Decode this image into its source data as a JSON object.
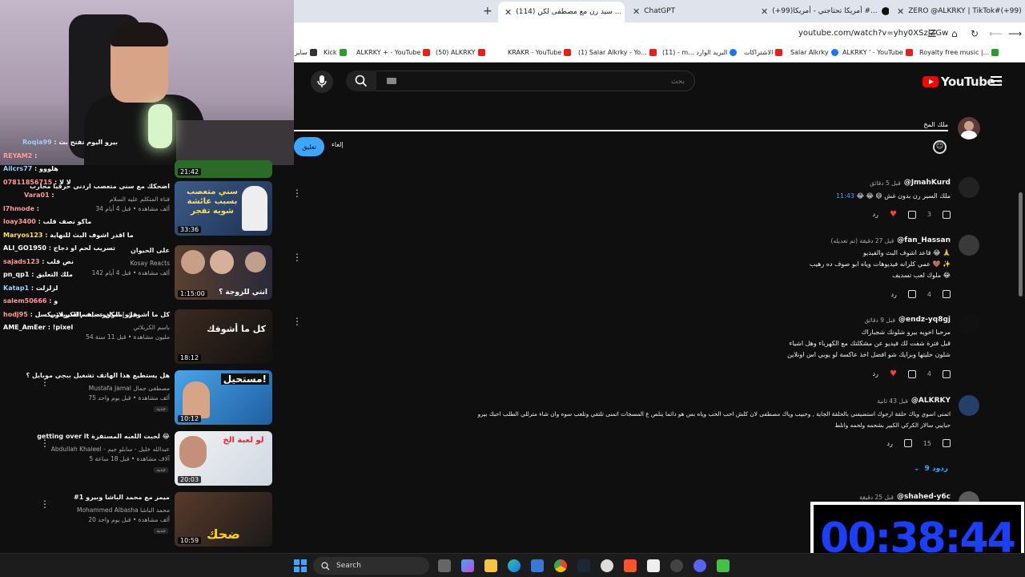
{
  "browser": {
    "tabs": [
      {
        "label": "ZERO @ALKRKY | TikTok#(+99)"
      },
      {
        "label": "(+99)أمريكا تحتاجني - أمريكا #..."
      },
      {
        "label": "ChatGPT"
      },
      {
        "label": "(114) سيد رن مع مصطفى لكن ..."
      }
    ],
    "url": "youtube.com/watch?v=yhy0XSzjZGw",
    "bookmarks": [
      "Royalty free music |...",
      "ALKRKY ' - YouTube",
      "Salar Alkrky",
      "الاشتراكات",
      "(11) - m... البريد الوارد",
      "(1) Salar Alkrky - Yo...",
      "KRAKR - YouTube",
      "(50) ALKRKY",
      "ALKRKY + - YouTube",
      "Kick",
      "ساير"
    ]
  },
  "youtube": {
    "logo": "YouTube",
    "logo_sup": "IQ",
    "search_placeholder": "بحث"
  },
  "comment_box": {
    "value": "ملك المخ",
    "submit": "تعليق",
    "cancel": "إلغاء"
  },
  "comments": [
    {
      "author": "@JmahKurd",
      "time": "قبل 5 دقائق",
      "body_ts": "11:43",
      "body": "ملك السير رن بدون غش 😄 😂 😂",
      "likes": "3",
      "reply": "رد"
    },
    {
      "author": "@fan_Hassan",
      "time": "قبل 27 دقيقة (تم تعديله)",
      "lines": [
        "قاعد اشوف البث والفيديو 😂 🙏",
        "عمي كلرانه فيديوهات وياه ابو صوف ده رهيب 🤎 ✨",
        "ملوك لعب تسديف 😂"
      ],
      "likes": "4",
      "reply": "رد"
    },
    {
      "author": "@endz-yq8gj",
      "time": "قبل 9 دقائق",
      "lines": [
        "مرحبا اخويه بيرو شلونك شجباراك",
        "قبل فترة شفت لك فيديو عن مشكلتك مع الكهرباء وهل اشياء",
        "شلون حليتها وبرايك شو افضل اخذ عاكسة لو يوبي اس اونلاين"
      ],
      "likes": "4",
      "reply": "رد"
    },
    {
      "author": "@ALKRKY",
      "time": "قبل 43 ثانية",
      "lines": [
        "اتمنى اسوي وياك حلقة ارجوك استضيفني بالحلقة الجاية , وحبيب وياك مصطفى لان كلش احب الحب وياه بس هو دائما ينلص ع المسجات اتمنى تلتقي وتلعب سوه وان شاء مترللي الطلب احبك بيرو",
        "حبايبي سالار الكركي الكبير بشحمه ولحمه وانلط"
      ],
      "likes": "15",
      "reply": "رد",
      "replies_label": "9 ردود"
    },
    {
      "author": "@shahed-y6c",
      "time": "قبل 25 دقيقة"
    }
  ],
  "chat": [
    {
      "user": "Roqia99",
      "msg": "بيرو اليوم تفتح بث"
    },
    {
      "user": "REYAM2",
      "msg": ""
    },
    {
      "user": "Ailcrs77",
      "msg": "هلووو"
    },
    {
      "user": "07811856715",
      "msg": "لا لا"
    },
    {
      "user": "Vara01",
      "msg": ""
    },
    {
      "user": "l7hmode",
      "msg": ""
    },
    {
      "user": "loay3400",
      "msg": "ماكو نصف قلب"
    },
    {
      "user": "Maryos123",
      "msg": "ما اقدر اشوف البث للنهاية"
    },
    {
      "user": "ALI_GO1950",
      "msg": "تسريب لحم او دجاج"
    },
    {
      "user": "sajads123",
      "msg": "نص قلب"
    },
    {
      "user": "pn_qp1",
      "msg": "ملك التعليق"
    },
    {
      "user": "Katap1",
      "msg": "لزلزلت"
    },
    {
      "user": "salem50666",
      "msg": "و"
    },
    {
      "user": "hodj95",
      "msg": "بيرو ممكن تضيف السيرفر بكسل"
    },
    {
      "user": "AME_AmEer",
      "msg": "!pixel"
    }
  ],
  "videos": [
    {
      "title": "",
      "channel": "",
      "meta": "",
      "duration": "21:42"
    },
    {
      "title": "اضحكك مع سني متعصب اردني حرفيا محارب",
      "channel": "قناة المتكلم عليه السلام",
      "meta": "34 ألف مشاهدة • قبل 4 أيام",
      "duration": "33:36",
      "thumb_text": "سني متعصب بسبب عائشة شويه تفجر"
    },
    {
      "title": "على الحيوان",
      "channel": "Kosay Reacts",
      "meta": "142 ألف مشاهدة • قبل 4 أيام",
      "duration": "1:15:00",
      "thumb_text": "انتي للزوجة ؟"
    },
    {
      "title": "كل ما أشوفك | الرادود باسم الكربلائي",
      "channel": "باسم الكربلائي",
      "meta": "54 مليون مشاهدة • قبل 11 سنة",
      "duration": "18:12",
      "thumb_text": "كل ما أشوفك"
    },
    {
      "title": "هل يستطيع هذا الهاتف تشغيل ببجي موبايل ؟",
      "channel": "Mustafa Jamal مصطفى جمال",
      "meta": "75 ألف مشاهدة • قبل يوم واحد",
      "duration": "10:12",
      "thumb_text": "مستحيل!",
      "badge": "جديد"
    },
    {
      "title": "getting over it لحبت اللعبه المستفزة 😂",
      "channel": "Abdullah Khaleel - عبدالله خليل - سابلو جيم",
      "meta": "5 آلاف مشاهدة • قبل 18 ساعة",
      "duration": "20:03",
      "thumb_text": "لو لعبة الخ",
      "badge": "جديد"
    },
    {
      "title": "#1 ميمز مع محمد الباشا وبيرو",
      "channel": "Mohammed Albasha محمد الباشا",
      "meta": "20 ألف مشاهدة • قبل يوم واحد",
      "duration": "10:59",
      "thumb_text": "ضحك",
      "badge": "جديد"
    }
  ],
  "timer": "00:38:44",
  "taskbar": {
    "search": "Search"
  }
}
